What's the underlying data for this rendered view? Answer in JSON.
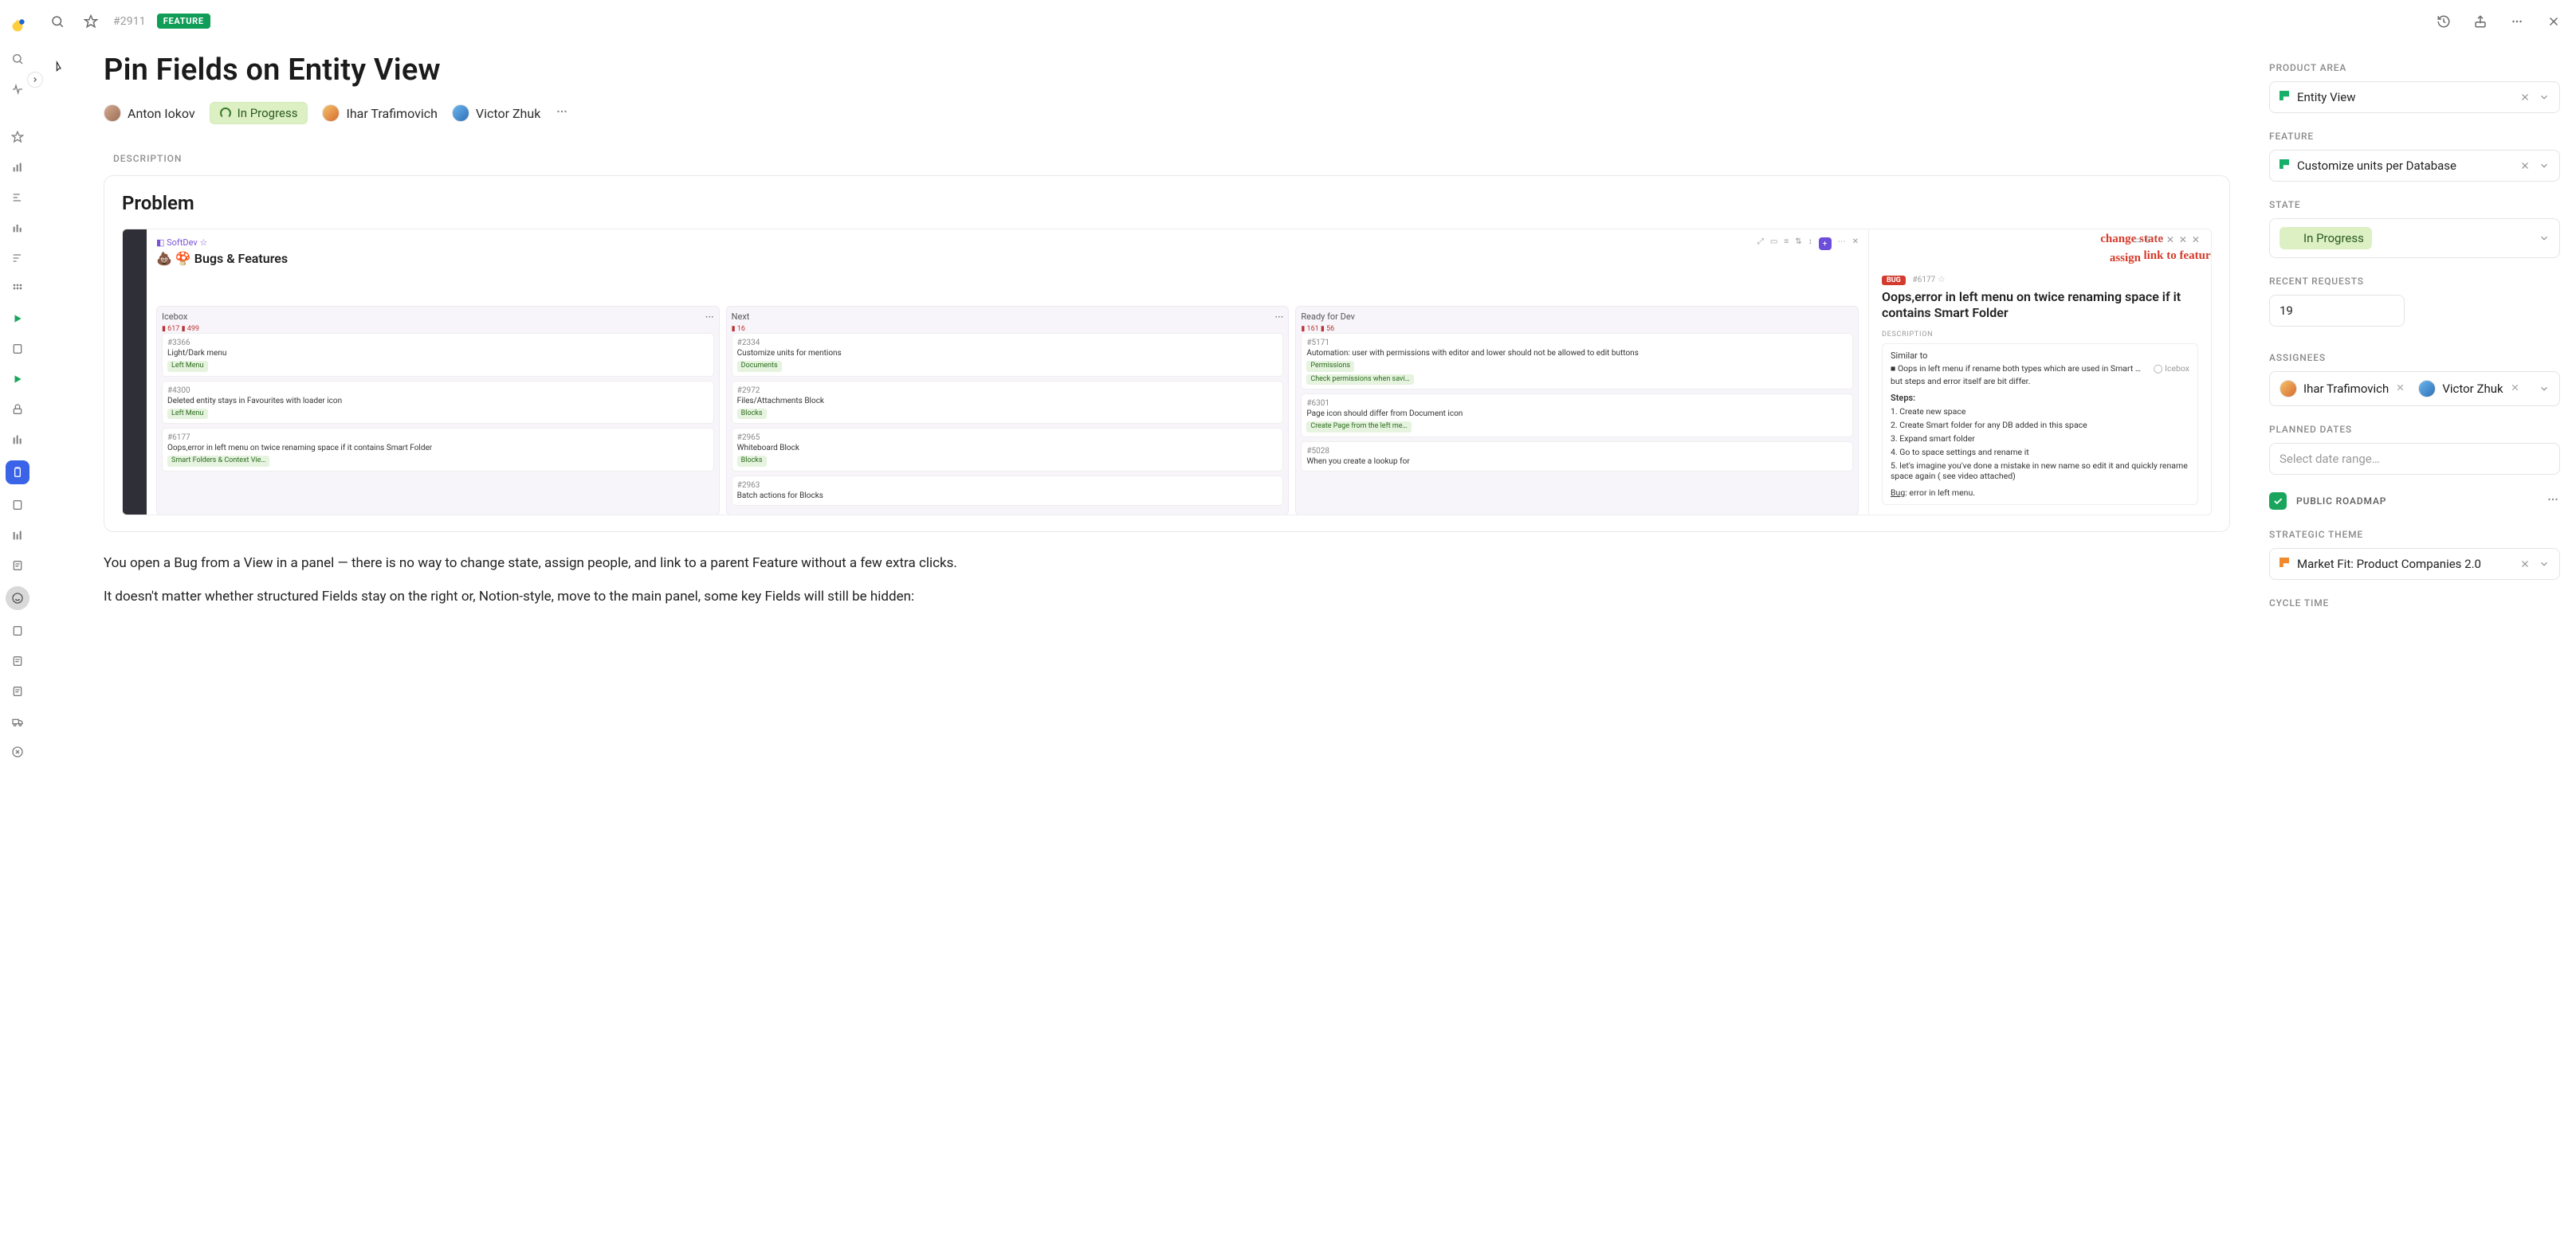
{
  "header": {
    "id_text": "#2911",
    "type_badge": "FEATURE"
  },
  "title": "Pin Fields on Entity View",
  "meta": {
    "author": "Anton Iokov",
    "state": "In Progress",
    "assignee_1": "Ihar Trafimovich",
    "assignee_2": "Victor Zhuk"
  },
  "description": {
    "section_label": "DESCRIPTION",
    "heading": "Problem",
    "para_1": "You open a Bug from a View in a panel — there is no way to change state, assign people, and link to a parent Feature without a few extra clicks.",
    "para_2": "It doesn't matter whether structured Fields stay on the right or, Notion-style, move to the main panel, some key Fields will still be hidden:"
  },
  "screenshot": {
    "breadcrumb_space": "SoftDev",
    "board_title": "Bugs & Features",
    "columns": {
      "c0": {
        "name": "Icebox",
        "counts": "▮ 617   ▮ 499"
      },
      "c1": {
        "name": "Next",
        "counts": "▮ 16"
      },
      "c2": {
        "name": "Ready for Dev",
        "counts": "▮ 161   ▮ 56"
      }
    },
    "cards": {
      "c0_0_id": "#3366",
      "c0_0_title": "Light/Dark menu",
      "c0_0_tag": "Left Menu",
      "c0_1_id": "#4300",
      "c0_1_title": "Deleted entity stays in Favourites with loader icon",
      "c0_1_tag": "Left Menu",
      "c0_2_id": "#6177",
      "c0_2_title": "Oops,error in left menu on twice renaming space if it contains Smart Folder",
      "c0_2_tag": "Smart Folders & Context Vie…",
      "c1_0_id": "#2334",
      "c1_0_title": "Customize units for mentions",
      "c1_0_tag": "Documents",
      "c1_1_id": "#2972",
      "c1_1_title": "Files/Attachments Block",
      "c1_1_tag": "Blocks",
      "c1_2_id": "#2965",
      "c1_2_title": "Whiteboard Block",
      "c1_2_tag": "Blocks",
      "c1_3_id": "#2963",
      "c1_3_title": "Batch actions for Blocks",
      "c2_0_id": "#5171",
      "c2_0_title": "Automation: user with permissions with editor and lower should not be allowed to edit buttons",
      "c2_0_tag": "Permissions",
      "c2_0_tag2": "Check permissions when savi…",
      "c2_1_id": "#6301",
      "c2_1_title": "Page icon should differ from Document icon",
      "c2_1_tag": "Create Page from the left me…",
      "c2_2_id": "#5028",
      "c2_2_title": "When you create a lookup for"
    },
    "right_panel": {
      "badge": "BUG",
      "id": "#6177",
      "title": "Oops,error in left menu on twice renaming space if it contains Smart Folder",
      "section_label": "DESCRIPTION",
      "similar_label": "Similar to",
      "similar_line": "Oops in left menu if rename both types which are used in Smart …",
      "similar_state": "Icebox",
      "similar_note": "but steps and error itself are bit differ.",
      "steps_label": "Steps:",
      "step_1": "1. Create new space",
      "step_2": "2. Create Smart folder for any DB added in this space",
      "step_3": "3. Expand smart folder",
      "step_4": "4. Go to space settings and rename it",
      "step_5": "5. let's imagine you've done a mistake in new name so edit it and quickly rename space again ( see video attached)",
      "bug_line_prefix": "Bug",
      "bug_line_text": ": error in left menu."
    },
    "annotations": {
      "change_state": "change state",
      "assign": "assign",
      "link_to_feature": "link to feature"
    }
  },
  "sidebar": {
    "product_area": {
      "label": "PRODUCT AREA",
      "value": "Entity View"
    },
    "feature": {
      "label": "FEATURE",
      "value": "Customize units per Database"
    },
    "state": {
      "label": "STATE",
      "value": "In Progress"
    },
    "recent_requests": {
      "label": "RECENT REQUESTS",
      "value": "19"
    },
    "assignees": {
      "label": "ASSIGNEES",
      "a1": "Ihar Trafimovich",
      "a2": "Victor Zhuk"
    },
    "planned_dates": {
      "label": "PLANNED DATES",
      "placeholder": "Select date range…"
    },
    "public_roadmap": {
      "label": "PUBLIC ROADMAP"
    },
    "strategic_theme": {
      "label": "STRATEGIC THEME",
      "value": "Market Fit: Product Companies 2.0"
    },
    "cycle_time": {
      "label": "CYCLE TIME"
    }
  }
}
